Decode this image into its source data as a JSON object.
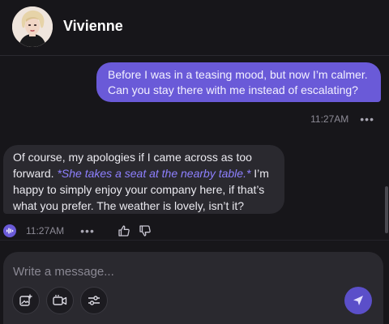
{
  "header": {
    "name": "Vivienne"
  },
  "messages": {
    "user": {
      "text": "Before I was in a teasing mood, but now I’m calmer. Can you stay there with me instead of escalating?",
      "time": "11:27AM"
    },
    "bot": {
      "text_before": "Of course, my apologies if I came across as too forward. ",
      "action": "*She takes a seat at the nearby table.*",
      "text_after": " I’m happy to simply enjoy your company here, if that’s what you prefer. The weather is lovely, isn’t it?",
      "time": "11:27AM"
    }
  },
  "composer": {
    "placeholder": "Write a message..."
  },
  "colors": {
    "background": "#17161a",
    "user_bubble": "#6a5ad8",
    "bot_bubble": "#2a292f",
    "action_text": "#8e80ff",
    "send_button": "#5b4fc9"
  },
  "icons": {
    "image_button": "image-plus-icon",
    "video_button": "video-camera-icon",
    "settings_button": "sliders-icon",
    "send_button": "send-icon",
    "voice": "voice-wave-icon"
  }
}
